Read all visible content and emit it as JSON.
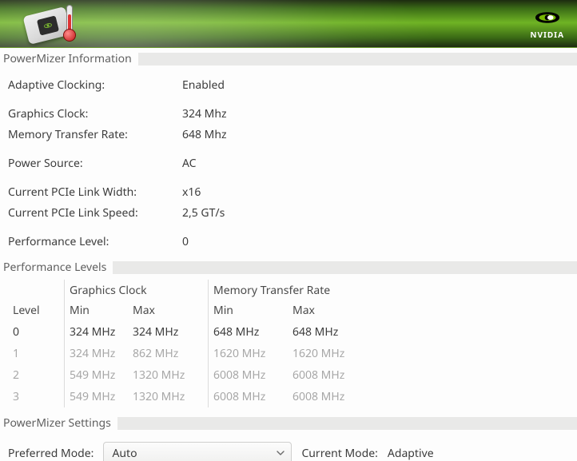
{
  "brand": {
    "name": "NVIDIA"
  },
  "sections": {
    "info_title": "PowerMizer Information",
    "levels_title": "Performance Levels",
    "settings_title": "PowerMizer Settings"
  },
  "info": {
    "adaptive_clocking": {
      "label": "Adaptive Clocking:",
      "value": "Enabled"
    },
    "graphics_clock": {
      "label": "Graphics Clock:",
      "value": "324 Mhz"
    },
    "memory_transfer": {
      "label": "Memory Transfer Rate:",
      "value": "648 Mhz"
    },
    "power_source": {
      "label": "Power Source:",
      "value": "AC"
    },
    "pcie_width": {
      "label": "Current PCIe Link Width:",
      "value": "x16"
    },
    "pcie_speed": {
      "label": "Current PCIe Link Speed:",
      "value": "2,5 GT/s"
    },
    "perf_level": {
      "label": "Performance Level:",
      "value": "0"
    }
  },
  "levels": {
    "headers": {
      "level": "Level",
      "graphics_clock": "Graphics Clock",
      "memory_transfer": "Memory Transfer Rate",
      "min": "Min",
      "max": "Max"
    },
    "rows": [
      {
        "level": "0",
        "gmin": "324 MHz",
        "gmax": "324 MHz",
        "mmin": "648 MHz",
        "mmax": "648 MHz",
        "current": true
      },
      {
        "level": "1",
        "gmin": "324 MHz",
        "gmax": "862 MHz",
        "mmin": "1620 MHz",
        "mmax": "1620 MHz",
        "current": false
      },
      {
        "level": "2",
        "gmin": "549 MHz",
        "gmax": "1320 MHz",
        "mmin": "6008 MHz",
        "mmax": "6008 MHz",
        "current": false
      },
      {
        "level": "3",
        "gmin": "549 MHz",
        "gmax": "1320 MHz",
        "mmin": "6008 MHz",
        "mmax": "6008 MHz",
        "current": false
      }
    ]
  },
  "settings": {
    "preferred_mode_label": "Preferred Mode:",
    "preferred_mode_value": "Auto",
    "current_mode_label": "Current Mode:",
    "current_mode_value": "Adaptive"
  }
}
